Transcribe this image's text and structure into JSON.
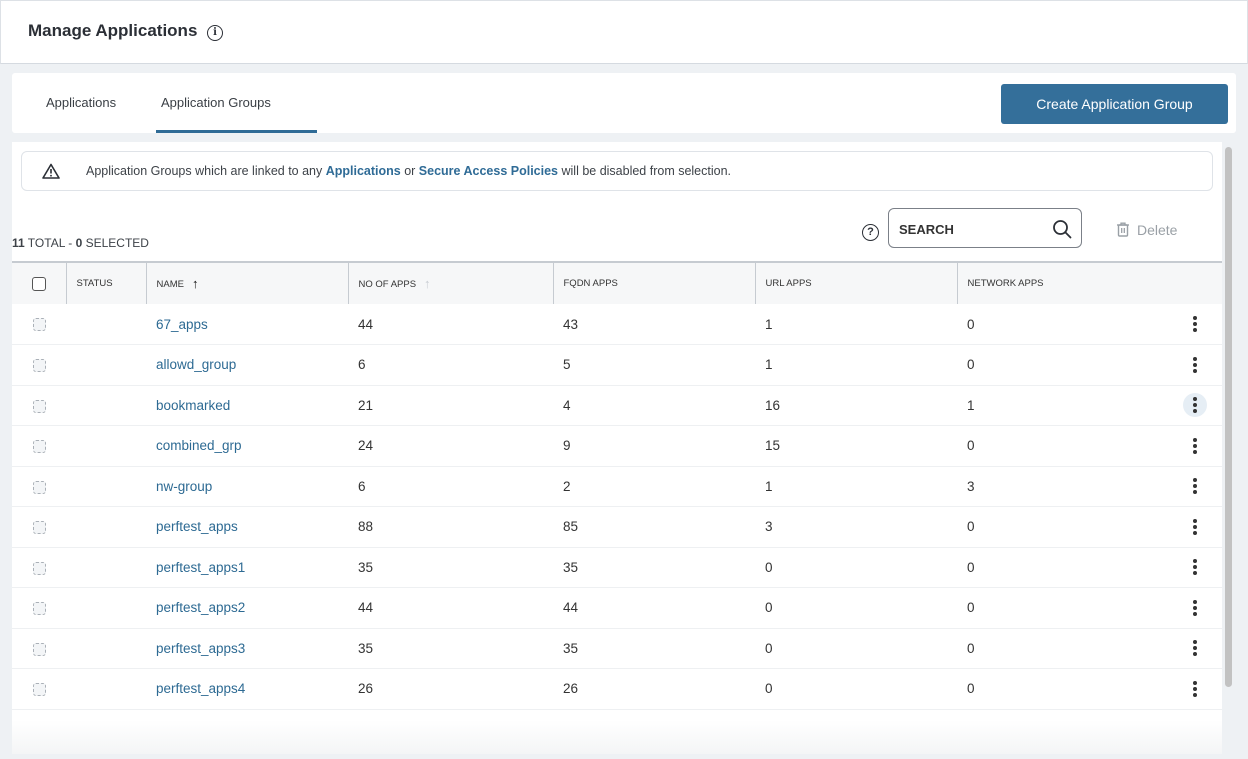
{
  "header": {
    "title": "Manage Applications",
    "info_icon": "info-icon"
  },
  "tabs": [
    {
      "label": "Applications",
      "active": false
    },
    {
      "label": "Application Groups",
      "active": true
    }
  ],
  "create_button": {
    "label": "Create Application Group"
  },
  "colors": {
    "accent": "#346f9a",
    "link": "#2d6a93",
    "active_tab_underline": "#2f6b96"
  },
  "alert": {
    "icon": "warning-icon",
    "text_prefix": "Application Groups which are linked to any ",
    "link1": "Applications",
    "text_middle": " or ",
    "link2": "Secure Access Policies",
    "text_suffix": " will be disabled from selection."
  },
  "summary": {
    "total": "11",
    "total_label": " TOTAL - ",
    "selected": "0",
    "selected_label": " SELECTED"
  },
  "toolbar": {
    "help_icon": "help-icon",
    "search_placeholder": "SEARCH",
    "search_value": "",
    "delete_label": "Delete"
  },
  "table": {
    "columns": [
      {
        "key": "select",
        "label": ""
      },
      {
        "key": "status",
        "label": "STATUS"
      },
      {
        "key": "name",
        "label": "NAME",
        "sort": "asc-active"
      },
      {
        "key": "no_of_apps",
        "label": "NO OF APPS",
        "sort": "inactive"
      },
      {
        "key": "fqdn_apps",
        "label": "FQDN APPS"
      },
      {
        "key": "url_apps",
        "label": "URL APPS"
      },
      {
        "key": "network_apps",
        "label": "NETWORK APPS"
      },
      {
        "key": "actions",
        "label": ""
      }
    ],
    "sort_arrow": "↑",
    "rows": [
      {
        "name": "67_apps",
        "no_of_apps": "44",
        "fqdn_apps": "43",
        "url_apps": "1",
        "network_apps": "0"
      },
      {
        "name": "allowd_group",
        "no_of_apps": "6",
        "fqdn_apps": "5",
        "url_apps": "1",
        "network_apps": "0"
      },
      {
        "name": "bookmarked",
        "no_of_apps": "21",
        "fqdn_apps": "4",
        "url_apps": "16",
        "network_apps": "1",
        "hover": true
      },
      {
        "name": "combined_grp",
        "no_of_apps": "24",
        "fqdn_apps": "9",
        "url_apps": "15",
        "network_apps": "0"
      },
      {
        "name": "nw-group",
        "no_of_apps": "6",
        "fqdn_apps": "2",
        "url_apps": "1",
        "network_apps": "3"
      },
      {
        "name": "perftest_apps",
        "no_of_apps": "88",
        "fqdn_apps": "85",
        "url_apps": "3",
        "network_apps": "0"
      },
      {
        "name": "perftest_apps1",
        "no_of_apps": "35",
        "fqdn_apps": "35",
        "url_apps": "0",
        "network_apps": "0"
      },
      {
        "name": "perftest_apps2",
        "no_of_apps": "44",
        "fqdn_apps": "44",
        "url_apps": "0",
        "network_apps": "0"
      },
      {
        "name": "perftest_apps3",
        "no_of_apps": "35",
        "fqdn_apps": "35",
        "url_apps": "0",
        "network_apps": "0"
      },
      {
        "name": "perftest_apps4",
        "no_of_apps": "26",
        "fqdn_apps": "26",
        "url_apps": "0",
        "network_apps": "0"
      }
    ]
  }
}
